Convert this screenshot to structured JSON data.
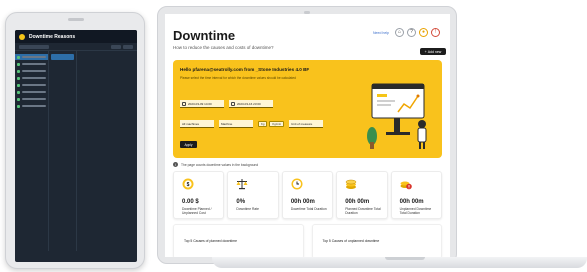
{
  "tablet": {
    "title": "Downtime Reasons"
  },
  "page": {
    "title": "Downtime",
    "subtitle": "How to reduce the causes and costs of downtime?",
    "header_link": "Need help",
    "create_label": "Add new",
    "note": "The page counts downtime values in the background"
  },
  "banner": {
    "greeting": "Hello pfarena@seatrolly.com from _Stone Industries 4.0 BF",
    "description": "Please select the time interval for which the downtime values should be calculated",
    "start_date": "2023-03-09 14:00",
    "end_date": "2023-03-16 23:00",
    "filter1": "All machines",
    "filter2": "Machine",
    "tag1": "Kg",
    "tag2": "Kg/min",
    "filter3": "Unit of measure",
    "apply_label": "Apply"
  },
  "kpis": [
    {
      "value": "0.00 $",
      "label": "Downtime Planned / Unplanned Cost"
    },
    {
      "value": "0%",
      "label": "Downtime Rate"
    },
    {
      "value": "00h 00m",
      "label": "Downtime Total Duration"
    },
    {
      "value": "00h 00m",
      "label": "Planned Downtime Total Duration"
    },
    {
      "value": "00h 00m",
      "label": "Unplanned Downtime Total Duration"
    }
  ],
  "panels": [
    {
      "title": "Top 5 Causes of planned downtime"
    },
    {
      "title": "Top 5 Causes of unplanned downtime"
    }
  ],
  "colors": {
    "accent": "#f9c21c",
    "tablet_bg": "#1e2733",
    "tablet_active": "#2d6ea8",
    "alert": "#d9342b"
  }
}
